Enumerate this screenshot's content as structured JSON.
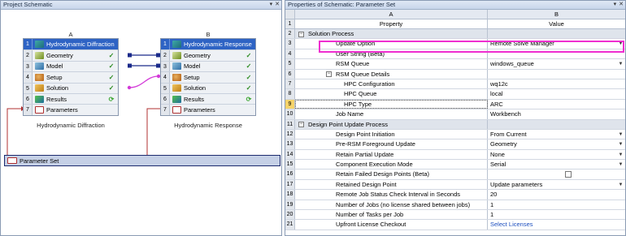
{
  "left_panel": {
    "title": "Project Schematic",
    "pin": "▾",
    "close": "✕"
  },
  "right_panel": {
    "title": "Properties of Schematic: Parameter Set",
    "pin": "▾",
    "close": "✕"
  },
  "system_a": {
    "letter": "A",
    "caption": "Hydrodynamic Diffraction",
    "rows": [
      {
        "n": "1",
        "label": "Hydrodynamic Diffraction",
        "status": ""
      },
      {
        "n": "2",
        "label": "Geometry",
        "status": "✓"
      },
      {
        "n": "3",
        "label": "Model",
        "status": "✓"
      },
      {
        "n": "4",
        "label": "Setup",
        "status": "✓"
      },
      {
        "n": "5",
        "label": "Solution",
        "status": "✓"
      },
      {
        "n": "6",
        "label": "Results",
        "status": "⟳"
      },
      {
        "n": "7",
        "label": "Parameters",
        "status": ""
      }
    ]
  },
  "system_b": {
    "letter": "B",
    "caption": "Hydrodynamic Response",
    "rows": [
      {
        "n": "1",
        "label": "Hydrodynamic Response",
        "status": ""
      },
      {
        "n": "2",
        "label": "Geometry",
        "status": "✓"
      },
      {
        "n": "3",
        "label": "Model",
        "status": "✓"
      },
      {
        "n": "4",
        "label": "Setup",
        "status": "✓"
      },
      {
        "n": "5",
        "label": "Solution",
        "status": "✓"
      },
      {
        "n": "6",
        "label": "Results",
        "status": "⟳"
      },
      {
        "n": "7",
        "label": "Parameters",
        "status": ""
      }
    ]
  },
  "parameter_set": {
    "label": "Parameter Set"
  },
  "properties": {
    "col_a": "A",
    "col_b": "B",
    "head_property": "Property",
    "head_value": "Value",
    "rows": [
      {
        "n": "2",
        "property": "Solution Process",
        "value": ""
      },
      {
        "n": "3",
        "property": "Update Option",
        "value": "Remote Solve Manager"
      },
      {
        "n": "4",
        "property": "User String (Beta)",
        "value": ""
      },
      {
        "n": "5",
        "property": "RSM Queue",
        "value": "windows_queue"
      },
      {
        "n": "6",
        "property": "RSM Queue Details",
        "value": ""
      },
      {
        "n": "7",
        "property": "HPC Configuration",
        "value": "wq12c"
      },
      {
        "n": "8",
        "property": "HPC Queue",
        "value": "local"
      },
      {
        "n": "9",
        "property": "HPC Type",
        "value": "ARC"
      },
      {
        "n": "10",
        "property": "Job Name",
        "value": "Workbench"
      },
      {
        "n": "11",
        "property": "Design Point Update Process",
        "value": ""
      },
      {
        "n": "12",
        "property": "Design Point Initiation",
        "value": "From Current"
      },
      {
        "n": "13",
        "property": "Pre-RSM Foreground Update",
        "value": "Geometry"
      },
      {
        "n": "14",
        "property": "Retain Partial Update",
        "value": "None"
      },
      {
        "n": "15",
        "property": "Component Execution Mode",
        "value": "Serial"
      },
      {
        "n": "16",
        "property": "Retain Failed Design Points (Beta)",
        "value": ""
      },
      {
        "n": "17",
        "property": "Retained Design Point",
        "value": "Update parameters"
      },
      {
        "n": "18",
        "property": "Remote Job Status Check Interval in Seconds",
        "value": "20"
      },
      {
        "n": "19",
        "property": "Number of Jobs (no license shared between jobs)",
        "value": "1"
      },
      {
        "n": "20",
        "property": "Number of Tasks per Job",
        "value": "1"
      },
      {
        "n": "21",
        "property": "Upfront License Checkout",
        "value": "Select Licenses"
      }
    ]
  },
  "colors": {
    "highlight": "#ef2ed0",
    "header_blue": "#2e63c4",
    "link_blue": "#1d4fbf"
  }
}
